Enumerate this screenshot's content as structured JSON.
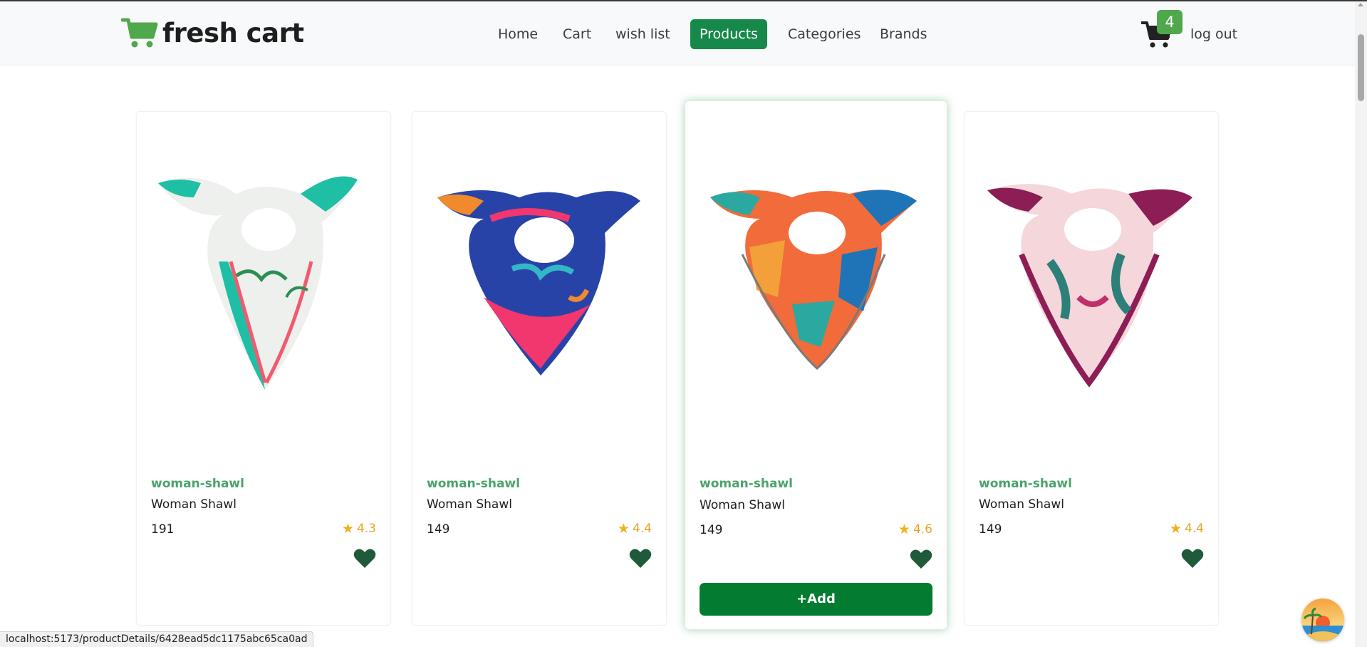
{
  "navbar": {
    "brand": "fresh cart",
    "links": [
      {
        "label": "Home",
        "active": false
      },
      {
        "label": "Cart",
        "active": false
      },
      {
        "label": "wish list",
        "active": false
      },
      {
        "label": "Products",
        "active": true
      },
      {
        "label": "Categories",
        "active": false
      },
      {
        "label": "Brands",
        "active": false
      }
    ],
    "cart_count": "4",
    "logout_label": "log out"
  },
  "products": [
    {
      "category": "woman-shawl",
      "name": "Woman Shawl",
      "price": "191",
      "rating": "4.3",
      "scarf_colors": [
        "#1fbfa6",
        "#f25a6e",
        "#eef0ee",
        "#2b8f52"
      ]
    },
    {
      "category": "woman-shawl",
      "name": "Woman Shawl",
      "price": "149",
      "rating": "4.4",
      "scarf_colors": [
        "#2743a8",
        "#f2366e",
        "#f08a2c",
        "#34b6c9"
      ]
    },
    {
      "category": "woman-shawl",
      "name": "Woman Shawl",
      "price": "149",
      "rating": "4.6",
      "scarf_colors": [
        "#1f74b8",
        "#f26b3a",
        "#f3a03a",
        "#2ba9a0"
      ]
    },
    {
      "category": "woman-shawl",
      "name": "Woman Shawl",
      "price": "149",
      "rating": "4.4",
      "scarf_colors": [
        "#8c1d55",
        "#f4d6db",
        "#2d7f7a",
        "#c02f6a"
      ]
    }
  ],
  "hovered_card_add_label": "+Add",
  "status_bar_url": "localhost:5173/productDetails/6428ead5dc1175abc65ca0ad",
  "colors": {
    "brand_green": "#4fa84b",
    "primary_green": "#16894a",
    "category_green": "#4aa36a",
    "heart_green": "#1f5a3a",
    "star_gold": "#f2b01e"
  }
}
